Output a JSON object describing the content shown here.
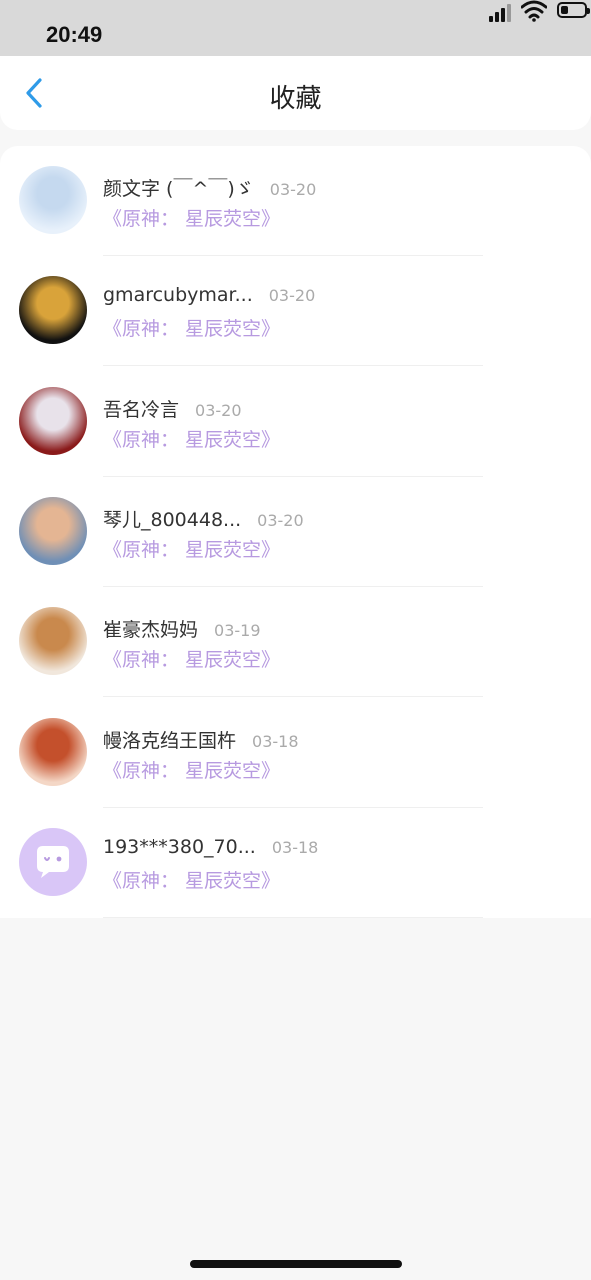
{
  "status_bar": {
    "time": "20:49",
    "battery_level": 0.3
  },
  "nav": {
    "title": "收藏",
    "back_icon": "chevron-left-icon",
    "accent_color": "#2f9be8"
  },
  "items": [
    {
      "user": "颜文字 (￣^￣)ゞ",
      "date": "03-20",
      "work": "《原神：  星辰荧空》",
      "avatar_colors": [
        "#e8f1fb",
        "#c5d9ef"
      ]
    },
    {
      "user": "gmarcubymar...",
      "date": "03-20",
      "work": "《原神：  星辰荧空》",
      "avatar_colors": [
        "#111111",
        "#d9a33a"
      ]
    },
    {
      "user": "吾名冷言",
      "date": "03-20",
      "work": "《原神：  星辰荧空》",
      "avatar_colors": [
        "#8a1a1a",
        "#e8e2ea"
      ]
    },
    {
      "user": "琴儿_800448...",
      "date": "03-20",
      "work": "《原神：  星辰荧空》",
      "avatar_colors": [
        "#6f8fb6",
        "#e4b593"
      ]
    },
    {
      "user": "崔豪杰妈妈",
      "date": "03-19",
      "work": "《原神：  星辰荧空》",
      "avatar_colors": [
        "#f1e7dc",
        "#c9894d"
      ]
    },
    {
      "user": "幔洛克绉王国杵",
      "date": "03-18",
      "work": "《原神：  星辰荧空》",
      "avatar_colors": [
        "#f4d7c6",
        "#c4502c"
      ]
    },
    {
      "user": "193***380_70...",
      "date": "03-18",
      "work": "《原神：  星辰荧空》",
      "avatar_colors": [
        "#d9c6f7",
        "#ffffff"
      ]
    }
  ],
  "colors": {
    "work_title": "#b79ae0",
    "date": "#aaaaaa",
    "background": "#f7f7f7"
  }
}
